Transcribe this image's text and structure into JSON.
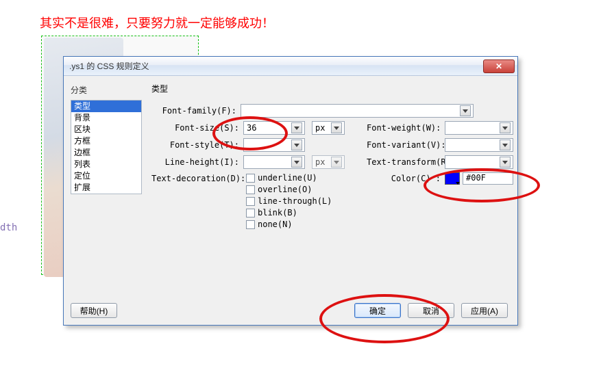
{
  "bg": {
    "text": "其实不是很难，只要努力就一定能够成功！",
    "side": "dth"
  },
  "dialog": {
    "title": ".ys1 的 CSS 规则定义",
    "close": "✕",
    "sidebar": {
      "title": "分类",
      "items": [
        "类型",
        "背景",
        "区块",
        "方框",
        "边框",
        "列表",
        "定位",
        "扩展"
      ]
    },
    "main": {
      "title": "类型",
      "fontFamilyLabel": "Font-family(F):",
      "fontSizeLabel": "Font-size(S):",
      "fontSizeValue": "36",
      "fontSizeUnit": "px",
      "fontWeightLabel": "Font-weight(W):",
      "fontStyleLabel": "Font-style(T):",
      "fontVariantLabel": "Font-variant(V):",
      "lineHeightLabel": "Line-height(I):",
      "lineHeightUnit": "px",
      "textTransformLabel": "Text-transform(R):",
      "textDecorationLabel": "Text-decoration(D):",
      "decoOptions": {
        "underline": "underline(U)",
        "overline": "overline(O)",
        "lineThrough": "line-through(L)",
        "blink": "blink(B)",
        "none": "none(N)"
      },
      "colorLabel": "Color(C) :",
      "colorValue": "#00F"
    },
    "buttons": {
      "help": "帮助(H)",
      "ok": "确定",
      "cancel": "取消",
      "apply": "应用(A)"
    }
  }
}
